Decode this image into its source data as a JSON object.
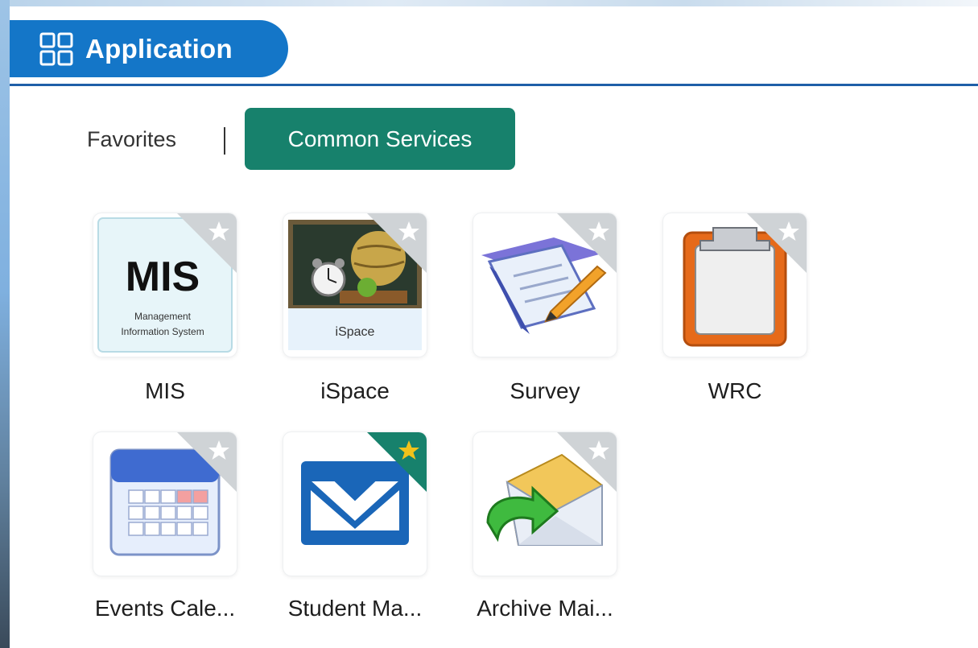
{
  "header": {
    "title": "Application",
    "icon": "apps-grid-icon"
  },
  "tabs": {
    "favorites": "Favorites",
    "common_services": "Common Services",
    "active": "Common Services"
  },
  "tiles": [
    {
      "label": "MIS",
      "icon": "mis-logo-icon",
      "logo_big": "MIS",
      "logo_line1": "Management",
      "logo_line2": "Information System",
      "favorited": false
    },
    {
      "label": "iSpace",
      "icon": "ispace-chalkboard-icon",
      "art_caption": "iSpace",
      "favorited": false
    },
    {
      "label": "Survey",
      "icon": "survey-form-pencil-icon",
      "favorited": false
    },
    {
      "label": "WRC",
      "icon": "clipboard-icon",
      "favorited": false
    },
    {
      "label": "Events Cale...",
      "icon": "calendar-icon",
      "favorited": false
    },
    {
      "label": "Student Ma...",
      "icon": "student-mail-icon",
      "favorited": true
    },
    {
      "label": "Archive Mai...",
      "icon": "archive-mail-icon",
      "favorited": false
    }
  ],
  "colors": {
    "header_blue": "#1476c8",
    "active_tab_green": "#17816c",
    "favorite_star": "#f2c21b",
    "favorite_corner_active": "#17816c",
    "favorite_corner_inactive": "#cfd3d6"
  }
}
